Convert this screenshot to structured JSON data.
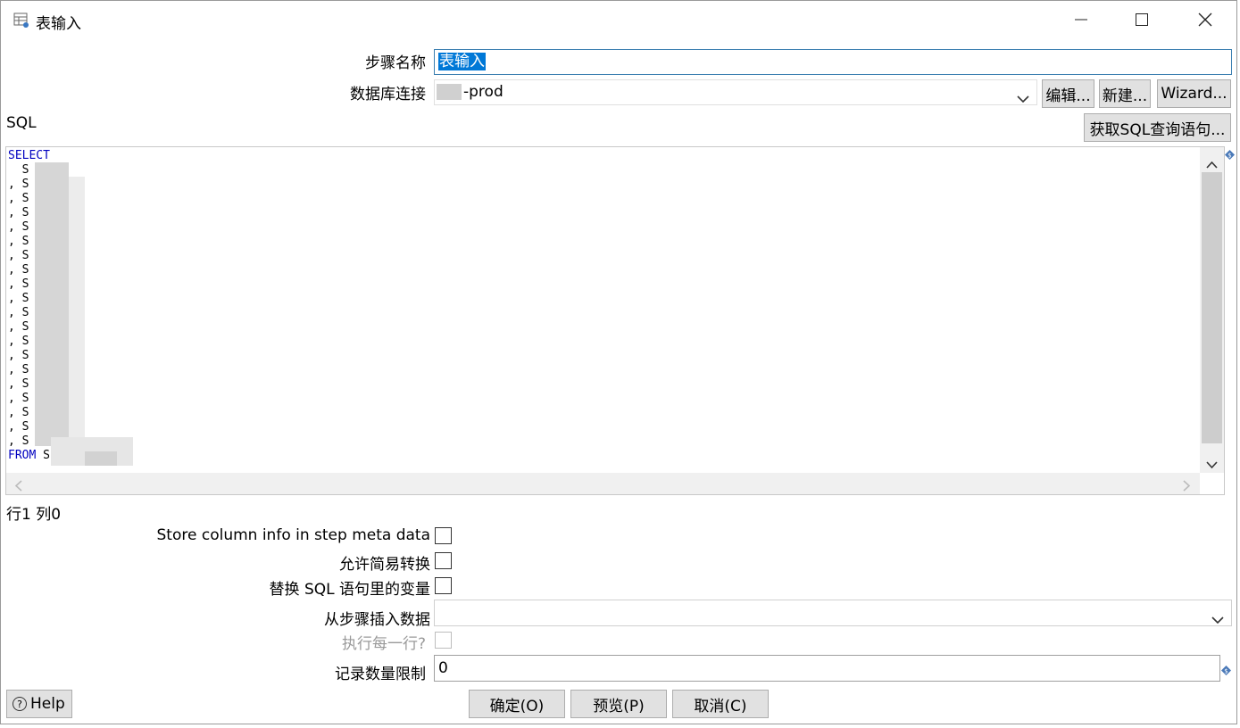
{
  "window": {
    "title": "表输入",
    "minimize": "—",
    "maximize": "☐",
    "close": "✕"
  },
  "form": {
    "step_name_label": "步骤名称",
    "step_name_value": "表输入",
    "db_conn_label": "数据库连接",
    "db_conn_value": "-prod",
    "edit_button": "编辑...",
    "new_button": "新建...",
    "wizard_button": "Wizard...",
    "sql_label": "SQL",
    "get_sql_button": "获取SQL查询语句...",
    "cursor_pos": "行1 列0",
    "store_col_label": "Store column info in step meta data",
    "lazy_conv_label": "允许简易转换",
    "replace_var_label": "替换 SQL 语句里的变量",
    "insert_from_label": "从步骤插入数据",
    "insert_from_value": "",
    "exec_each_label": "执行每一行?",
    "limit_label": "记录数量限制",
    "limit_value": "0"
  },
  "sql": {
    "lines": [
      "SELECT",
      "  S",
      ", S",
      ", S",
      ", S",
      ", S",
      ", S",
      ", S",
      ", S",
      ", S",
      ", S",
      ", S",
      ", S",
      ", S",
      ", S",
      ", S",
      ", S",
      ", S",
      ", S",
      ", S",
      ", S",
      "FROM S"
    ]
  },
  "footer": {
    "help_button": "Help",
    "ok_button": "确定(O)",
    "preview_button": "预览(P)",
    "cancel_button": "取消(C)"
  },
  "colors": {
    "keyword": "#0000c0",
    "selection": "#0078d7",
    "button_bg": "#e1e1e1",
    "scrollbar_thumb": "#cdcdcd"
  }
}
